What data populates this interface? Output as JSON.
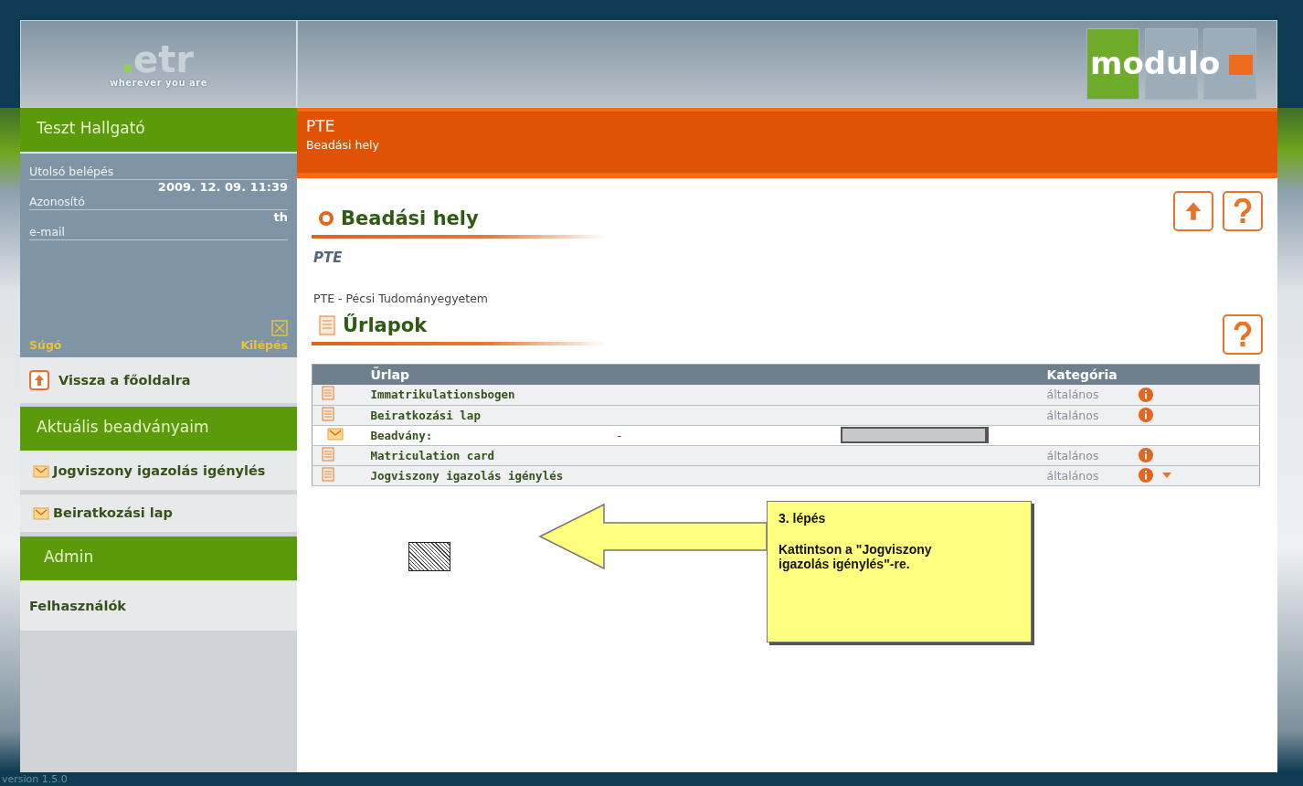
{
  "header": {
    "logo_text": "etr",
    "logo_tagline": "wherever you are",
    "brand": "modulo"
  },
  "user": {
    "name": "Teszt Hallgató",
    "fields": [
      {
        "label": "Utolsó belépés",
        "value": "2009. 12. 09. 11:39"
      },
      {
        "label": "Azonosító",
        "value": "th"
      },
      {
        "label": "e-mail"
      }
    ],
    "help": "Súgó",
    "logout": "Kilépés"
  },
  "sidebar": {
    "back": "Vissza a főoldalra",
    "sections": [
      {
        "title": "Aktuális beadványaim",
        "items": [
          {
            "label": "Jogviszony igazolás igénylés",
            "kind": "submission"
          },
          {
            "label": "Beiratkozási lap",
            "kind": "submission"
          }
        ]
      },
      {
        "title": "Admin",
        "items": [
          {
            "label": "Felhasználók",
            "kind": "plain"
          }
        ]
      }
    ]
  },
  "page_header": {
    "title": "PTE",
    "subtitle": "Beadási hely"
  },
  "location": {
    "heading": "Beadási hely",
    "name": "PTE",
    "description": "PTE - Pécsi Tudományegyetem"
  },
  "forms": {
    "heading": "Űrlapok",
    "columns": [
      "Űrlap",
      "Kategória"
    ],
    "rows": [
      {
        "kind": "form",
        "name": "Immatrikulationsbogen",
        "category": "általános",
        "expandable": false
      },
      {
        "kind": "form",
        "name": "Beiratkozási lap",
        "category": "általános",
        "expandable": false
      },
      {
        "kind": "submission",
        "name": "Beadvány:",
        "value": "-"
      },
      {
        "kind": "form",
        "name": "Matriculation card",
        "category": "általános",
        "expandable": false
      },
      {
        "kind": "form",
        "name": "Jogviszony igazolás igénylés",
        "category": "általános",
        "expandable": true
      }
    ]
  },
  "callout": {
    "step": "3. lépés",
    "text": "Kattintson a \"Jogviszony igazolás igénylés\"-re."
  },
  "footer": {
    "version": "version 1.5.0"
  }
}
